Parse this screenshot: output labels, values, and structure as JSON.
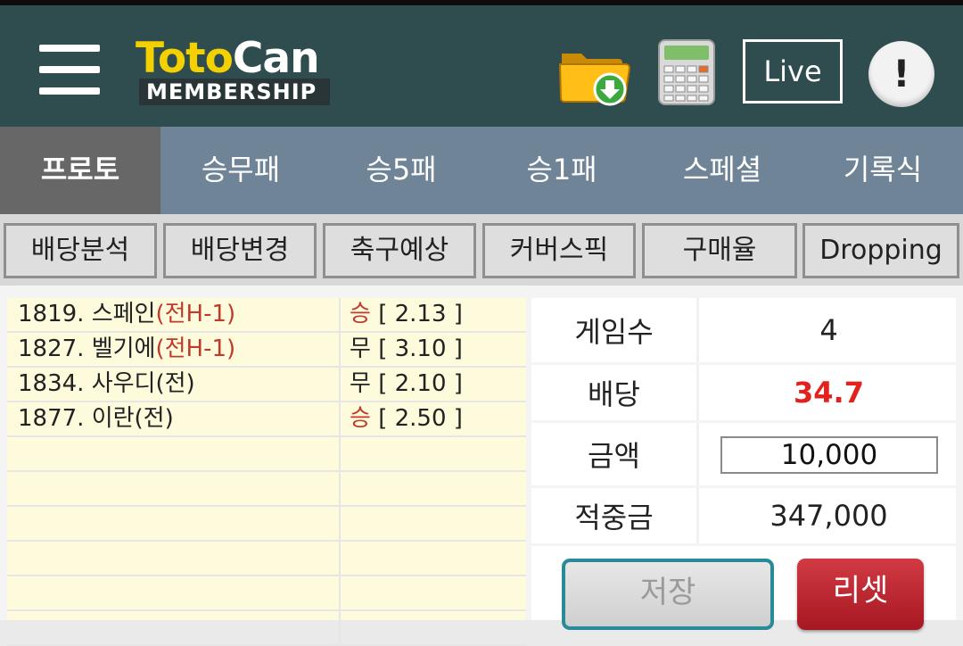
{
  "header": {
    "logo_title_part1": "Toto",
    "logo_title_part2": "Can",
    "logo_subtitle": "MEMBERSHIP",
    "live_label": "Live",
    "info_label": "!",
    "icons": [
      "menu-icon",
      "download-folder-icon",
      "calculator-icon",
      "info-icon"
    ]
  },
  "main_tabs": [
    {
      "label": "프로토",
      "active": true
    },
    {
      "label": "승무패",
      "active": false
    },
    {
      "label": "승5패",
      "active": false
    },
    {
      "label": "승1패",
      "active": false
    },
    {
      "label": "스페셜",
      "active": false
    },
    {
      "label": "기록식",
      "active": false
    }
  ],
  "sub_tabs": [
    {
      "label": "배당분석"
    },
    {
      "label": "배당변경"
    },
    {
      "label": "축구예상"
    },
    {
      "label": "커버스픽"
    },
    {
      "label": "구매율"
    },
    {
      "label": "Dropping"
    }
  ],
  "bets": [
    {
      "game": "1819. 스페인",
      "handicap": "(전H-1)",
      "pick": "승",
      "odds": "[ 2.13 ]",
      "pick_color": "red"
    },
    {
      "game": "1827. 벨기에",
      "handicap": "(전H-1)",
      "pick": "무",
      "odds": "[ 3.10 ]",
      "pick_color": "black"
    },
    {
      "game": "1834. 사우디(전)",
      "handicap": "",
      "pick": "무",
      "odds": "[ 2.10 ]",
      "pick_color": "black"
    },
    {
      "game": "1877. 이란(전)",
      "handicap": "",
      "pick": "승",
      "odds": "[ 2.50 ]",
      "pick_color": "red"
    }
  ],
  "summary": {
    "games_label": "게임수",
    "games_value": "4",
    "odds_label": "배당",
    "odds_value": "34.7",
    "amount_label": "금액",
    "amount_value": "10,000",
    "payout_label": "적중금",
    "payout_value": "347,000"
  },
  "buttons": {
    "save_label": "저장",
    "reset_label": "리셋"
  },
  "colors": {
    "header_bg": "#2f4c4e",
    "tab_bar_bg": "#6f8597",
    "tab_active_bg": "#676767",
    "bet_list_bg": "#fdfbdc",
    "odds_highlight": "#e3221f",
    "reset_button": "#b8232c",
    "save_button_border": "#2a8b98"
  }
}
